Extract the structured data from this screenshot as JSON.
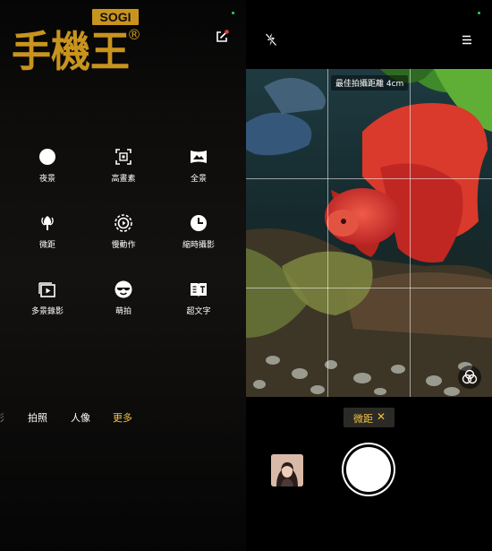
{
  "watermark": {
    "brand_top": "SOGI",
    "brand_main": "手機王",
    "reg_mark": "®"
  },
  "modes": [
    {
      "label": "夜景",
      "icon": "night-mode-icon"
    },
    {
      "label": "高畫素",
      "icon": "high-resolution-icon"
    },
    {
      "label": "全景",
      "icon": "panorama-icon"
    },
    {
      "label": "微距",
      "icon": "macro-icon"
    },
    {
      "label": "慢動作",
      "icon": "slow-motion-icon"
    },
    {
      "label": "縮時攝影",
      "icon": "time-lapse-icon"
    },
    {
      "label": "多景錄影",
      "icon": "multi-scene-video-icon"
    },
    {
      "label": "萌拍",
      "icon": "cute-shot-icon"
    },
    {
      "label": "超文字",
      "icon": "super-text-icon"
    }
  ],
  "mode_tabs": [
    {
      "label": "影"
    },
    {
      "label": "拍照"
    },
    {
      "label": "人像"
    },
    {
      "label": "更多",
      "active": true
    }
  ],
  "viewfinder": {
    "hint": "最佳拍攝距離 4cm"
  },
  "macro_chip": {
    "label": "微距",
    "close": "✕"
  },
  "colors": {
    "accent": "#f3c33c",
    "indicator": "#27d36b",
    "chip_bg": "#2b2a27"
  }
}
